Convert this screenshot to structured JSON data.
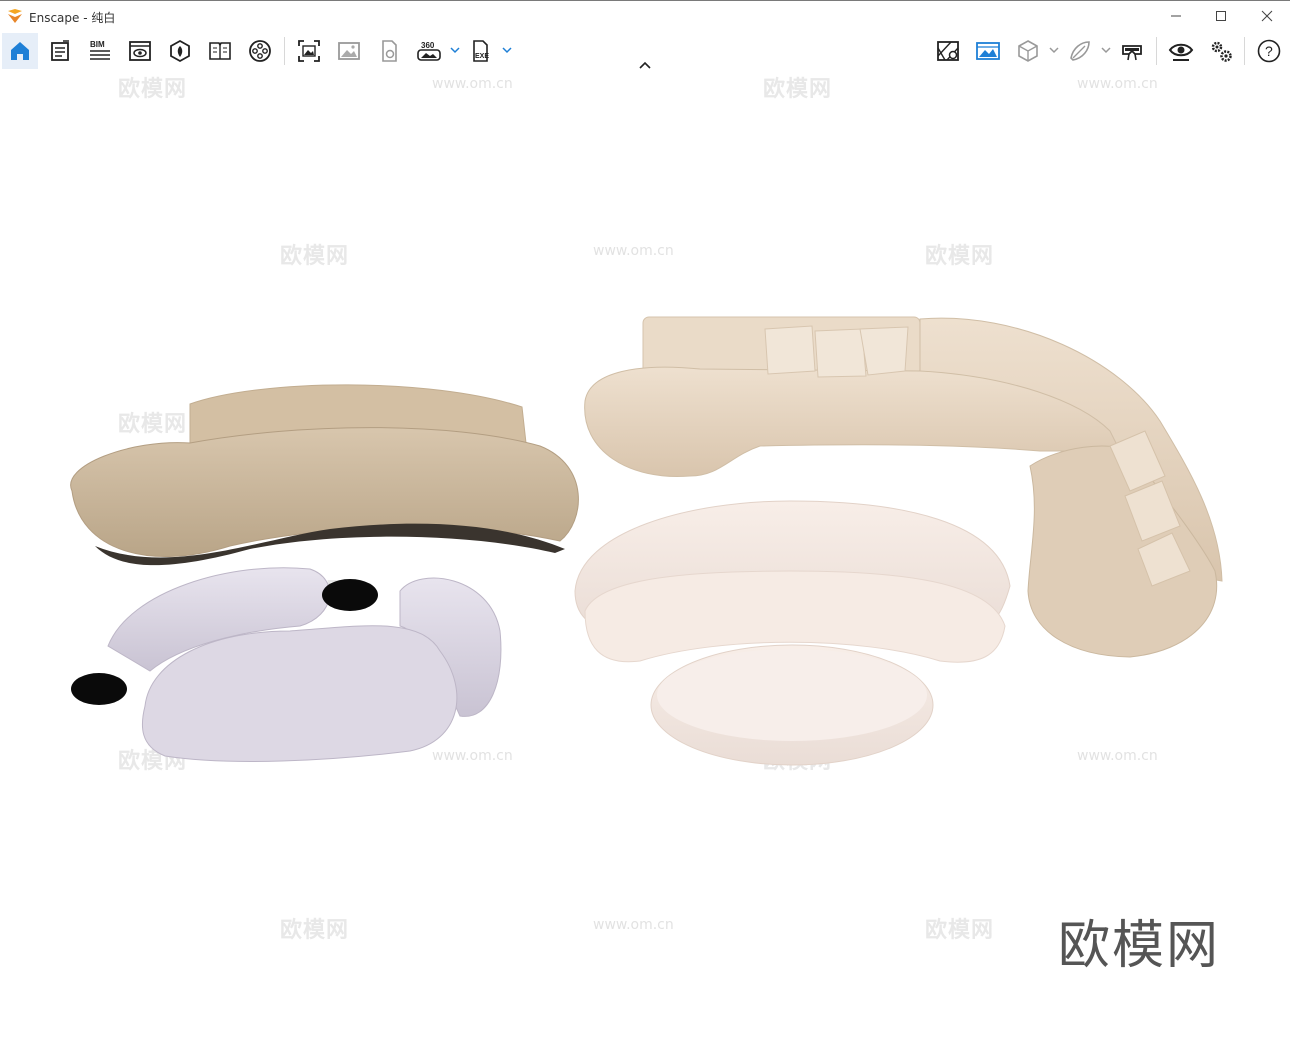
{
  "window": {
    "app_name": "Enscape",
    "separator": " - ",
    "document_name": "纯白",
    "title": "Enscape - 纯白"
  },
  "toolbar": {
    "left_buttons": [
      "home-icon",
      "log-icon",
      "bim-icon",
      "visual-settings-icon",
      "asset-library-icon",
      "material-book-icon",
      "video-reel-icon",
      "screenshot-icon",
      "image-icon",
      "export-file-icon",
      "panorama-360-icon",
      "exe-export-icon"
    ],
    "bim_label": "BIM",
    "pano_label": "360",
    "exe_label": "EXE",
    "right_buttons": [
      "site-context-icon",
      "view-sync-icon",
      "ortho-cube-icon",
      "light-view-icon",
      "vr-headset-icon",
      "eye-icon",
      "settings-gears-icon",
      "help-icon"
    ],
    "help_label": "?",
    "accent_color": "#1e7fd6"
  },
  "watermark": {
    "cn_text": "欧模网",
    "url_text": "www.om.cn",
    "brand_text": "欧模网"
  }
}
